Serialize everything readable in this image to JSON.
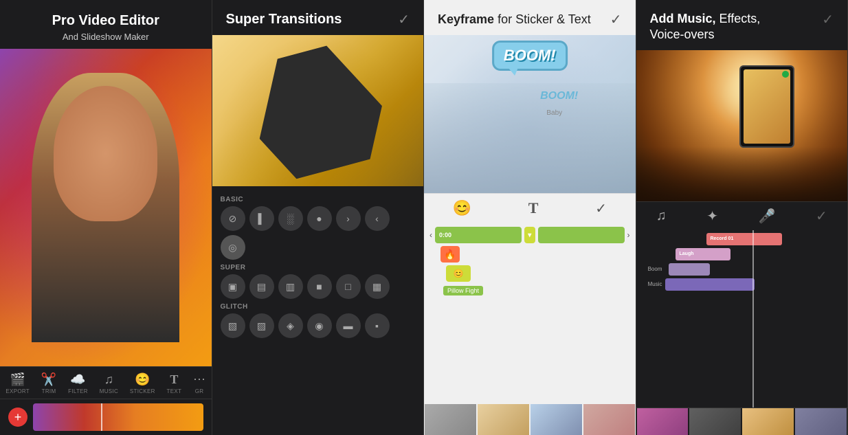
{
  "panels": [
    {
      "id": "panel1",
      "header": {
        "main_title": "Pro Video Editor",
        "sub_title": "And Slideshow Maker"
      },
      "toolbar": {
        "items": [
          {
            "icon": "🎬",
            "label": "EXPORT"
          },
          {
            "icon": "✂️",
            "label": "TRIM"
          },
          {
            "icon": "☁️",
            "label": "FILTER"
          },
          {
            "icon": "🎵",
            "label": "MUSIC"
          },
          {
            "icon": "😊",
            "label": "STICKER"
          },
          {
            "icon": "T",
            "label": "TEXT"
          },
          {
            "icon": "⋯",
            "label": "GR"
          }
        ]
      },
      "add_button": "+"
    },
    {
      "id": "panel2",
      "header": {
        "title": "Super Transitions",
        "check": "✓"
      },
      "sections": [
        {
          "label": "BASIC",
          "icons": [
            "⊘",
            "▌",
            "░",
            "●",
            ">",
            "<",
            "◎"
          ]
        },
        {
          "label": "SUPER",
          "icons": [
            "▣",
            "▤",
            "▥",
            "■",
            "□",
            "▦"
          ]
        },
        {
          "label": "GLITCH",
          "icons": [
            "▧",
            "▨",
            "▩",
            "▪",
            "▫",
            "▬"
          ]
        }
      ]
    },
    {
      "id": "panel3",
      "header": {
        "title_normal": "for Sticker & Text",
        "title_bold": "Keyframe"
      },
      "check": "✓",
      "boom_text": "BOOM!",
      "boom2_text": "BOOM!",
      "sticker_label": "Pillow Fight",
      "toolbar_icons": [
        "😊",
        "T",
        "✓"
      ]
    },
    {
      "id": "panel4",
      "header": {
        "title_normal": " Effects,\nVoice-overs",
        "title_bold": "Add Music,"
      },
      "check": "✓",
      "toolbar_icons": [
        "🎵",
        "✨",
        "🎤",
        "✓"
      ],
      "tracks": [
        {
          "label": "Record 01",
          "type": "record"
        },
        {
          "label": "Laugh",
          "type": "laugh"
        },
        {
          "label": "Boom",
          "type": "boom"
        },
        {
          "label": "Music",
          "type": "music"
        }
      ]
    }
  ]
}
